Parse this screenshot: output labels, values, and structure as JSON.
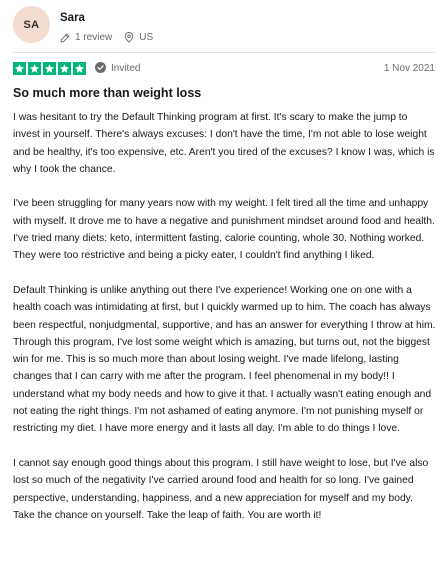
{
  "review": {
    "avatar_initials": "SA",
    "reviewer_name": "Sara",
    "review_count": "1 review",
    "country": "US",
    "star_count": 5,
    "invited_label": "Invited",
    "date": "1 Nov 2021",
    "title": "So much more than weight loss",
    "paragraphs": [
      "I was hesitant to try the Default Thinking program at first. It's scary to make the jump to invest in yourself. There's always excuses: I don't have the time, I'm not able to lose weight and be healthy, it's too expensive, etc. Aren't you tired of the excuses? I know I was, which is why I took the chance.",
      "I've been struggling for many years now with my weight. I felt tired all the time and unhappy with myself. It drove me to have a negative and punishment mindset around food and health. I've tried many diets: keto, intermittent fasting, calorie counting, whole 30. Nothing worked. They were too restrictive and being a picky eater, I couldn't find anything I liked.",
      "Default Thinking is unlike anything out there I've experience! Working one on one with a health coach was intimidating at first, but I quickly warmed up to him. The coach has always been respectful, nonjudgmental, supportive, and has an answer for everything I throw at him. Through this program, I've lost some weight which is amazing, but turns out, not the biggest win for me. This is so much more than about losing weight. I've made lifelong, lasting changes that I can carry with me after the program. I feel phenomenal in my body!! I understand what my body needs and how to give it that. I actually wasn't eating enough and not eating the right things. I'm not ashamed of eating anymore. I'm not punishing myself or restricting my diet. I have more energy and it lasts all day. I'm able to do things I love.",
      "I cannot say enough good things about this program. I still have weight to lose, but I've also lost so much of the negativity I've carried around food and health for so long. I've gained perspective, understanding, happiness, and a new appreciation for myself and my body. Take the chance on yourself. Take the leap of faith. You are worth it!"
    ]
  },
  "colors": {
    "star_green": "#00b67a",
    "avatar_bg": "#f3ddd0",
    "muted_text": "#6b6b6b"
  },
  "icons": [
    "pencil-icon",
    "location-pin-icon",
    "star-icon",
    "check-circle-icon"
  ]
}
